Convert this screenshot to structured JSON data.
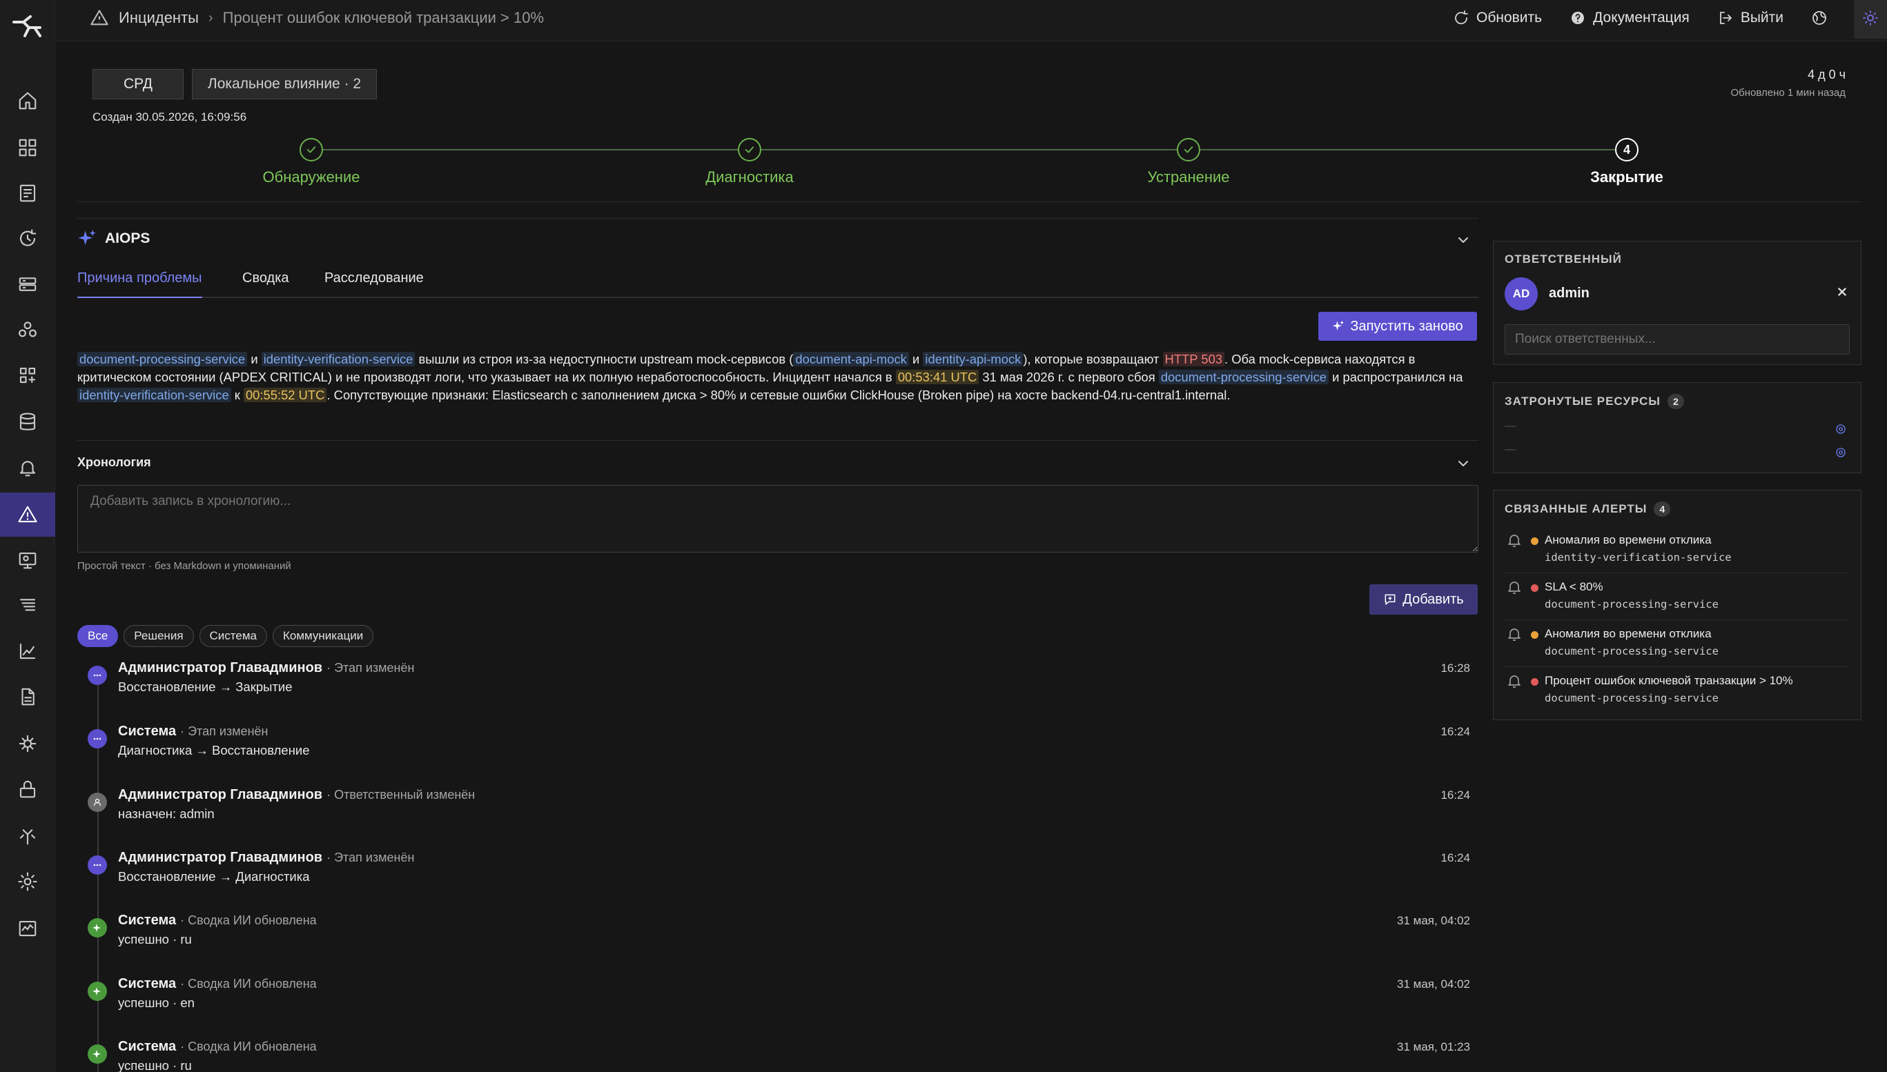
{
  "breadcrumb": {
    "root": "Инциденты",
    "separator": "›",
    "current": "Процент ошибок ключевой транзакции > 10%"
  },
  "top_actions": {
    "refresh": "Обновить",
    "docs": "Документация",
    "logout": "Выйти"
  },
  "sidebar": {
    "items": [
      "home-icon",
      "dashboard-grid-icon",
      "services-icon",
      "sync-icon",
      "servers-icon",
      "topology-icon",
      "apps-grid-icon",
      "database-icon",
      "alerts-bell-icon",
      "incidents-warning-icon",
      "monitors-icon",
      "logs-icon",
      "metrics-chart-icon",
      "reports-document-icon",
      "network-icon",
      "security-lock-icon",
      "integrations-icon",
      "settings-gear-icon",
      "activity-icon"
    ],
    "active": "incidents-warning-icon"
  },
  "incident": {
    "tag_srd": "СРД",
    "tag_impact": "Локальное влияние · 2",
    "created": "Создан 30.05.2026, 16:09:56",
    "duration": "4 д 0 ч",
    "updated": "Обновлено 1 мин назад"
  },
  "stepper": {
    "steps": [
      {
        "label": "Обнаружение",
        "state": "done"
      },
      {
        "label": "Диагностика",
        "state": "done"
      },
      {
        "label": "Устранение",
        "state": "done"
      },
      {
        "label": "Закрытие",
        "state": "current",
        "number": "4"
      }
    ]
  },
  "aiops": {
    "title": "AIOPS",
    "tabs": [
      "Причина проблемы",
      "Сводка",
      "Расследование"
    ],
    "active_tab": "Причина проблемы",
    "rerun_label": "Запустить заново",
    "cause": {
      "svc1": "document-processing-service",
      "and1": " и ",
      "svc2": "identity-verification-service",
      "t1": " вышли из строя из-за недоступности upstream mock-сервисов (",
      "mock1": "document-api-mock",
      "and2": " и ",
      "mock2": "identity-api-mock",
      "t2": "), которые возвращают ",
      "http": "HTTP 503",
      "t3": ". Оба mock-сервиса находятся в критическом состоянии (APDEX CRITICAL) и не производят логи, что указывает на их полную неработоспособность. Инцидент начался в ",
      "time1": "00:53:41 UTC",
      "t4": " 31 мая 2026 г. с первого сбоя ",
      "svc3": "document-processing-service",
      "t5": " и распространился на ",
      "svc4": "identity-verification-service",
      "t6": " к ",
      "time2": "00:55:52 UTC",
      "t7": ". Сопутствующие признаки: Elasticsearch с заполнением диска > 80% и сетевые ошибки ClickHouse (Broken pipe) на хосте backend-04.ru-central1.internal."
    }
  },
  "chronology": {
    "title": "Хронология",
    "input_placeholder": "Добавить запись в хронологию...",
    "hint": "Простой текст · без Markdown и упоминаний",
    "add_label": "Добавить",
    "filters": [
      "Все",
      "Решения",
      "Система",
      "Коммуникации"
    ],
    "active_filter": "Все",
    "entries": [
      {
        "author": "Администратор Главадминов",
        "action": "· Этап изменён",
        "detail": "Восстановление → Закрытие",
        "time": "16:28",
        "dot": "purple"
      },
      {
        "author": "Система",
        "action": "· Этап изменён",
        "detail": "Диагностика → Восстановление",
        "time": "16:24",
        "dot": "purple"
      },
      {
        "author": "Администратор Главадминов",
        "action": "· Ответственный изменён",
        "detail": "назначен: admin",
        "time": "16:24",
        "dot": "gray"
      },
      {
        "author": "Администратор Главадминов",
        "action": "· Этап изменён",
        "detail": "Восстановление → Диагностика",
        "time": "16:24",
        "dot": "purple"
      },
      {
        "author": "Система",
        "action": "· Сводка ИИ обновлена",
        "detail": "успешно · ru",
        "time": "31 мая, 04:02",
        "dot": "green"
      },
      {
        "author": "Система",
        "action": "· Сводка ИИ обновлена",
        "detail": "успешно · en",
        "time": "31 мая, 04:02",
        "dot": "green"
      },
      {
        "author": "Система",
        "action": "· Сводка ИИ обновлена",
        "detail": "успешно · ru",
        "time": "31 мая, 01:23",
        "dot": "green"
      }
    ]
  },
  "assignee": {
    "title": "ОТВЕТСТВЕННЫЙ",
    "initials": "AD",
    "name": "admin",
    "search_placeholder": "Поиск ответственных..."
  },
  "resources": {
    "title": "ЗАТРОНУТЫЕ РЕСУРСЫ",
    "count": "2",
    "items": [
      "—",
      "—"
    ]
  },
  "alerts": {
    "title": "СВЯЗАННЫЕ АЛЕРТЫ",
    "count": "4",
    "items": [
      {
        "title": "Аномалия во времени отклика",
        "service": "identity-verification-service",
        "severity": "#e8a13a"
      },
      {
        "title": "SLA < 80%",
        "service": "document-processing-service",
        "severity": "#e35a5a"
      },
      {
        "title": "Аномалия во времени отклика",
        "service": "document-processing-service",
        "severity": "#e8a13a"
      },
      {
        "title": "Процент ошибок ключевой транзакции > 10%",
        "service": "document-processing-service",
        "severity": "#e35a5a"
      }
    ]
  },
  "colors": {
    "accent": "#5b4fd0",
    "link": "#7c84f6",
    "success": "#6ab04c",
    "background": "#161616"
  }
}
